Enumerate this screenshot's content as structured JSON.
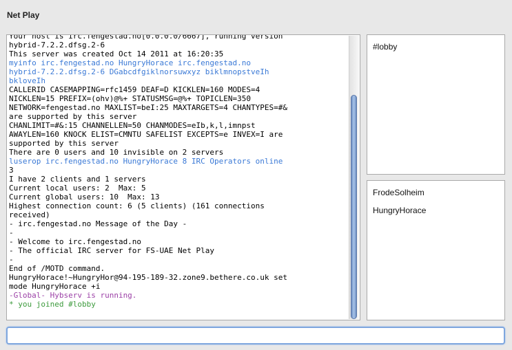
{
  "window": {
    "title": "Net Play"
  },
  "chat": {
    "lines": [
      {
        "text": "Your host is irc.fengestad.no[0.0.0.0/6667], running version",
        "color": "black"
      },
      {
        "text": "hybrid-7.2.2.dfsg.2-6",
        "color": "black"
      },
      {
        "text": "This server was created Oct 14 2011 at 16:20:35",
        "color": "black"
      },
      {
        "text": "myinfo irc.fengestad.no HungryHorace irc.fengestad.no",
        "color": "blue"
      },
      {
        "text": "hybrid-7.2.2.dfsg.2-6 DGabcdfgiklnorsuwxyz biklmnopstveIh",
        "color": "blue"
      },
      {
        "text": "bkloveIh",
        "color": "blue"
      },
      {
        "text": "CALLERID CASEMAPPING=rfc1459 DEAF=D KICKLEN=160 MODES=4",
        "color": "black"
      },
      {
        "text": "NICKLEN=15 PREFIX=(ohv)@%+ STATUSMSG=@%+ TOPICLEN=350",
        "color": "black"
      },
      {
        "text": "NETWORK=fengestad.no MAXLIST=beI:25 MAXTARGETS=4 CHANTYPES=#&",
        "color": "black"
      },
      {
        "text": "are supported by this server",
        "color": "black"
      },
      {
        "text": "CHANLIMIT=#&:15 CHANNELLEN=50 CHANMODES=eIb,k,l,imnpst",
        "color": "black"
      },
      {
        "text": "AWAYLEN=160 KNOCK ELIST=CMNTU SAFELIST EXCEPTS=e INVEX=I are",
        "color": "black"
      },
      {
        "text": "supported by this server",
        "color": "black"
      },
      {
        "text": "There are 0 users and 10 invisible on 2 servers",
        "color": "black"
      },
      {
        "text": "luserop irc.fengestad.no HungryHorace 8 IRC Operators online",
        "color": "blue"
      },
      {
        "text": "3",
        "color": "black"
      },
      {
        "text": "I have 2 clients and 1 servers",
        "color": "black"
      },
      {
        "text": "Current local users: 2  Max: 5",
        "color": "black"
      },
      {
        "text": "Current global users: 10  Max: 13",
        "color": "black"
      },
      {
        "text": "Highest connection count: 6 (5 clients) (161 connections",
        "color": "black"
      },
      {
        "text": "received)",
        "color": "black"
      },
      {
        "text": "- irc.fengestad.no Message of the Day -",
        "color": "black"
      },
      {
        "text": "-",
        "color": "black"
      },
      {
        "text": "- Welcome to irc.fengestad.no",
        "color": "black"
      },
      {
        "text": "- The official IRC server for FS-UAE Net Play",
        "color": "black"
      },
      {
        "text": "-",
        "color": "black"
      },
      {
        "text": "End of /MOTD command.",
        "color": "black"
      },
      {
        "text": "HungryHorace!~HungryHor@94-195-189-32.zone9.bethere.co.uk set",
        "color": "black"
      },
      {
        "text": "mode HungryHorace +i",
        "color": "black"
      },
      {
        "text": "-Global- Hybserv is running.",
        "color": "purple"
      },
      {
        "text": "* you joined #lobby",
        "color": "green"
      }
    ]
  },
  "channels": {
    "items": [
      "#lobby"
    ]
  },
  "users": {
    "items": [
      "FrodeSolheim",
      "HungryHorace"
    ]
  },
  "input": {
    "value": "",
    "placeholder": ""
  },
  "colors": {
    "blue": "#3a79d6",
    "purple": "#9b3fa6",
    "green": "#3c9a3c",
    "focus": "#7ea6de"
  }
}
